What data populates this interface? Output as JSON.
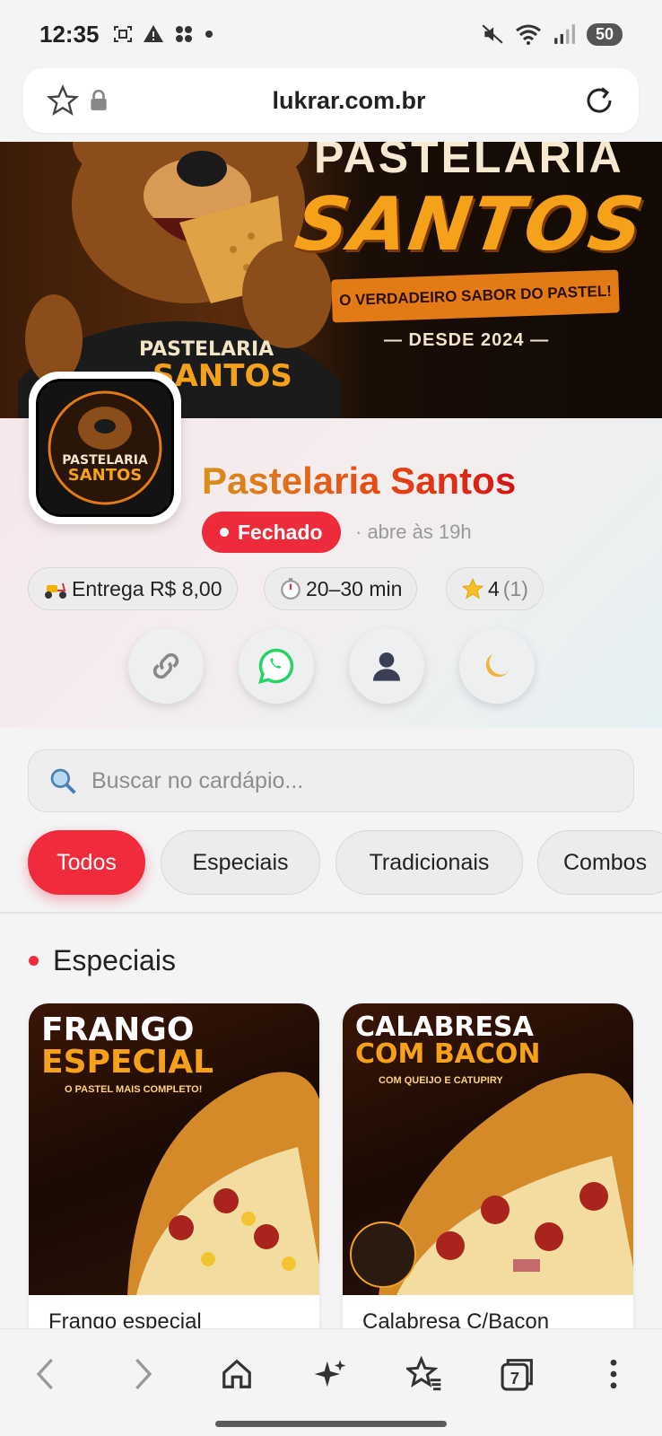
{
  "status_bar": {
    "time": "12:35",
    "battery": "50"
  },
  "browser": {
    "url": "lukrar.com.br",
    "tab_count": "7"
  },
  "banner": {
    "top_text": "PASTELARIA",
    "title": "SANTOS",
    "tagline": "O VERDADEIRO SABOR DO PASTEL!",
    "since": "— DESDE 2024 —"
  },
  "store": {
    "name": "Pastelaria Santos",
    "status": "Fechado",
    "opens_at": "· abre às 19h",
    "delivery": "Entrega R$ 8,00",
    "time": "20–30 min",
    "rating": "4",
    "rating_count": "(1)",
    "logo_text_top": "PASTELARIA",
    "logo_text_bottom": "SANTOS"
  },
  "search": {
    "placeholder": "Buscar no cardápio..."
  },
  "categories": [
    "Todos",
    "Especiais",
    "Tradicionais",
    "Combos"
  ],
  "section": {
    "title": "Especiais"
  },
  "products": [
    {
      "name": "Frango especial",
      "headline_1": "FRANGO",
      "headline_2": "ESPECIAL",
      "subtitle": "O PASTEL MAIS COMPLETO!"
    },
    {
      "name": "Calabresa C/Bacon",
      "headline_1": "CALABRESA",
      "headline_2": "COM BACON",
      "subtitle": "COM QUEIJO E CATUPIRY"
    }
  ],
  "colors": {
    "accent": "#ef2b3c",
    "brand_orange": "#e27a16"
  }
}
